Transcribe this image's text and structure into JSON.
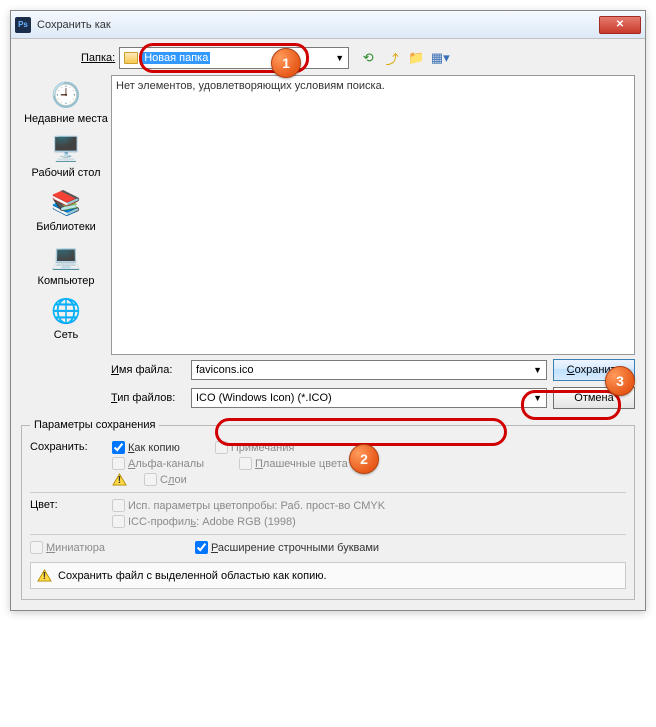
{
  "window": {
    "title": "Сохранить как"
  },
  "folder": {
    "label": "Папка:",
    "name": "Новая папка"
  },
  "nav": {
    "back": "back-icon",
    "up": "up-icon",
    "new": "new-folder-icon",
    "view": "view-icon"
  },
  "places": [
    {
      "name": "recent",
      "label": "Недавние места"
    },
    {
      "name": "desktop",
      "label": "Рабочий стол"
    },
    {
      "name": "libraries",
      "label": "Библиотеки"
    },
    {
      "name": "computer",
      "label": "Компьютер"
    },
    {
      "name": "network",
      "label": "Сеть"
    }
  ],
  "filearea": {
    "empty_msg": "Нет элементов, удовлетворяющих условиям поиска."
  },
  "file": {
    "name_label": "Имя файла:",
    "name_value": "favicons.ico",
    "type_label": "Тип файлов:",
    "type_value": "ICO (Windows Icon) (*.ICO)"
  },
  "buttons": {
    "save": "Сохранить",
    "cancel": "Отмена"
  },
  "params": {
    "legend": "Параметры сохранения",
    "save_row_label": "Сохранить:",
    "as_copy": "Как копию",
    "annotations": "Примечания",
    "alpha": "Альфа-каналы",
    "spot": "Плашечные цвета",
    "layers": "Слои",
    "color_row_label": "Цвет:",
    "color_proof": "Исп. параметры цветопробы: Раб. прост-во CMYK",
    "icc": "ICC-профиль: Adobe RGB (1998)",
    "thumb": "Миниатюра",
    "lowercase": "Расширение строчными буквами"
  },
  "info": {
    "msg": "Сохранить файл с выделенной областью как копию."
  },
  "callouts": {
    "c1": "1",
    "c2": "2",
    "c3": "3"
  }
}
